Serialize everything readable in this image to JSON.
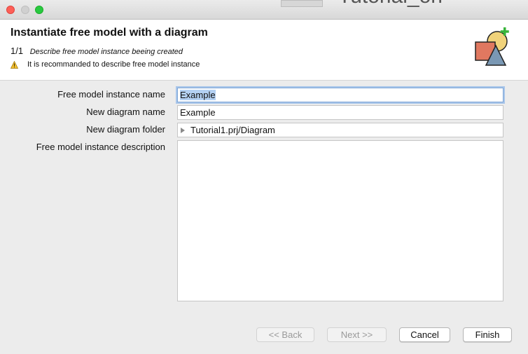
{
  "window": {
    "background_text": "Tutorial_on"
  },
  "header": {
    "title": "Instantiate free model with a diagram",
    "step_count": "1/1",
    "step_description": "Describe free model instance beeing created",
    "warning": "It is recommanded to describe free model instance",
    "icon": "free-model-diagram-icon"
  },
  "form": {
    "instance_name": {
      "label": "Free model instance name",
      "value": "Example"
    },
    "diagram_name": {
      "label": "New diagram name",
      "value": "Example"
    },
    "diagram_folder": {
      "label": "New diagram folder",
      "value": "Tutorial1.prj/Diagram"
    },
    "description": {
      "label": "Free model instance description",
      "value": ""
    }
  },
  "buttons": {
    "back": "<< Back",
    "next": "Next >>",
    "cancel": "Cancel",
    "finish": "Finish"
  },
  "colors": {
    "selection": "#b4d1f3",
    "focus_ring": "#a9c6ea",
    "desktop": "#8fbf3e"
  }
}
